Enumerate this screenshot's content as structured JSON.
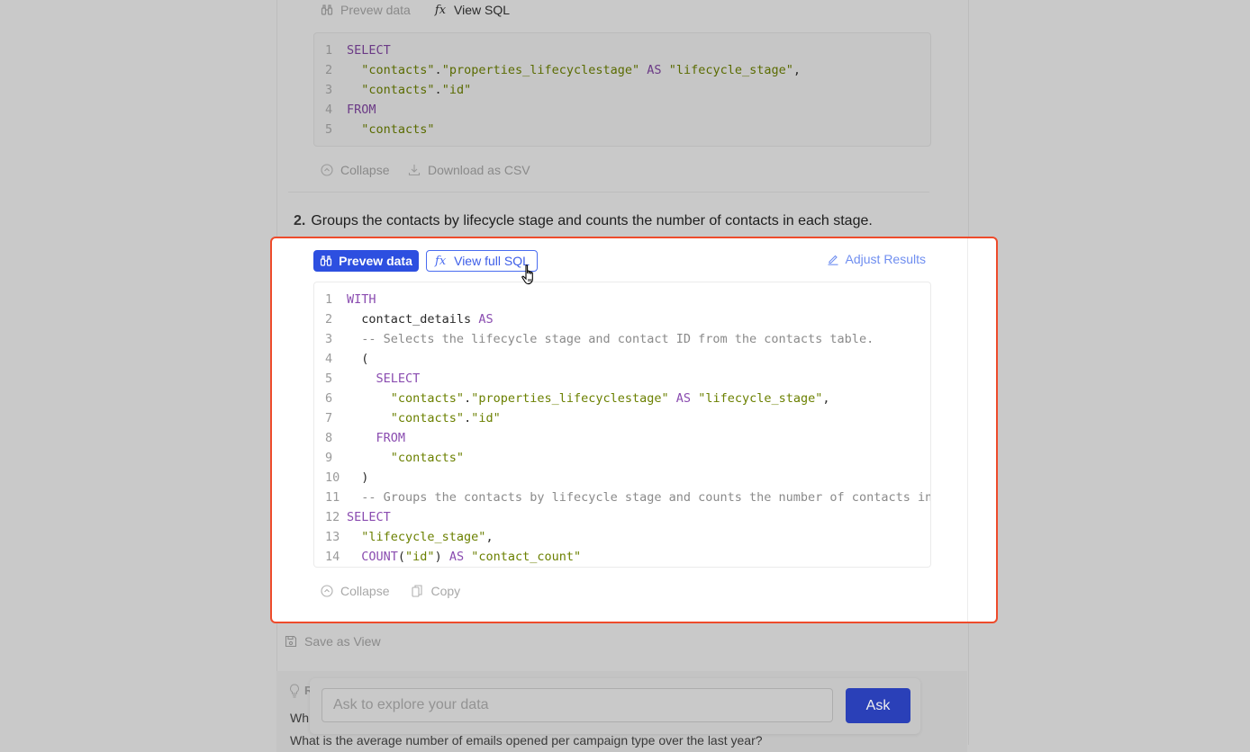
{
  "step1": {
    "toolbar": {
      "preview_label": "Prevew data",
      "view_sql_label": "View SQL"
    },
    "code": [
      {
        "n": "1",
        "tokens": [
          {
            "t": "kw",
            "v": "SELECT"
          }
        ]
      },
      {
        "n": "2",
        "tokens": [
          {
            "t": "pl",
            "v": "  "
          },
          {
            "t": "str",
            "v": "\"contacts\""
          },
          {
            "t": "pl",
            "v": "."
          },
          {
            "t": "str",
            "v": "\"properties_lifecyclestage\""
          },
          {
            "t": "pl",
            "v": " "
          },
          {
            "t": "kw",
            "v": "AS"
          },
          {
            "t": "pl",
            "v": " "
          },
          {
            "t": "str",
            "v": "\"lifecycle_stage\""
          },
          {
            "t": "pl",
            "v": ","
          }
        ]
      },
      {
        "n": "3",
        "tokens": [
          {
            "t": "pl",
            "v": "  "
          },
          {
            "t": "str",
            "v": "\"contacts\""
          },
          {
            "t": "pl",
            "v": "."
          },
          {
            "t": "str",
            "v": "\"id\""
          }
        ]
      },
      {
        "n": "4",
        "tokens": [
          {
            "t": "kw",
            "v": "FROM"
          }
        ]
      },
      {
        "n": "5",
        "tokens": [
          {
            "t": "pl",
            "v": "  "
          },
          {
            "t": "str",
            "v": "\"contacts\""
          }
        ]
      }
    ],
    "footer": {
      "collapse_label": "Collapse",
      "download_label": "Download as CSV"
    }
  },
  "step2": {
    "number": "2.",
    "description": "Groups the contacts by lifecycle stage and counts the number of contacts in each stage.",
    "toolbar": {
      "preview_label": "Prevew data",
      "view_full_sql_label": "View full SQL",
      "adjust_label": "Adjust Results"
    },
    "code": [
      {
        "n": "1",
        "tokens": [
          {
            "t": "kw",
            "v": "WITH"
          }
        ]
      },
      {
        "n": "2",
        "tokens": [
          {
            "t": "pl",
            "v": "  contact_details "
          },
          {
            "t": "kw",
            "v": "AS"
          }
        ]
      },
      {
        "n": "3",
        "tokens": [
          {
            "t": "com",
            "v": "  -- Selects the lifecycle stage and contact ID from the contacts table."
          }
        ]
      },
      {
        "n": "4",
        "tokens": [
          {
            "t": "pl",
            "v": "  ("
          }
        ]
      },
      {
        "n": "5",
        "tokens": [
          {
            "t": "pl",
            "v": "    "
          },
          {
            "t": "kw",
            "v": "SELECT"
          }
        ]
      },
      {
        "n": "6",
        "tokens": [
          {
            "t": "pl",
            "v": "      "
          },
          {
            "t": "str",
            "v": "\"contacts\""
          },
          {
            "t": "pl",
            "v": "."
          },
          {
            "t": "str",
            "v": "\"properties_lifecyclestage\""
          },
          {
            "t": "pl",
            "v": " "
          },
          {
            "t": "kw",
            "v": "AS"
          },
          {
            "t": "pl",
            "v": " "
          },
          {
            "t": "str",
            "v": "\"lifecycle_stage\""
          },
          {
            "t": "pl",
            "v": ","
          }
        ]
      },
      {
        "n": "7",
        "tokens": [
          {
            "t": "pl",
            "v": "      "
          },
          {
            "t": "str",
            "v": "\"contacts\""
          },
          {
            "t": "pl",
            "v": "."
          },
          {
            "t": "str",
            "v": "\"id\""
          }
        ]
      },
      {
        "n": "8",
        "tokens": [
          {
            "t": "pl",
            "v": "    "
          },
          {
            "t": "kw",
            "v": "FROM"
          }
        ]
      },
      {
        "n": "9",
        "tokens": [
          {
            "t": "pl",
            "v": "      "
          },
          {
            "t": "str",
            "v": "\"contacts\""
          }
        ]
      },
      {
        "n": "10",
        "tokens": [
          {
            "t": "pl",
            "v": "  )"
          }
        ]
      },
      {
        "n": "11",
        "tokens": [
          {
            "t": "com",
            "v": "  -- Groups the contacts by lifecycle stage and counts the number of contacts in each stage."
          }
        ]
      },
      {
        "n": "12",
        "tokens": [
          {
            "t": "kw",
            "v": "SELECT"
          }
        ]
      },
      {
        "n": "13",
        "tokens": [
          {
            "t": "pl",
            "v": "  "
          },
          {
            "t": "str",
            "v": "\"lifecycle_stage\""
          },
          {
            "t": "pl",
            "v": ","
          }
        ]
      },
      {
        "n": "14",
        "tokens": [
          {
            "t": "pl",
            "v": "  "
          },
          {
            "t": "kw",
            "v": "COUNT"
          },
          {
            "t": "pl",
            "v": "("
          },
          {
            "t": "str",
            "v": "\"id\""
          },
          {
            "t": "pl",
            "v": ") "
          },
          {
            "t": "kw",
            "v": "AS"
          },
          {
            "t": "pl",
            "v": " "
          },
          {
            "t": "str",
            "v": "\"contact_count\""
          }
        ]
      }
    ],
    "footer": {
      "collapse_label": "Collapse",
      "copy_label": "Copy"
    }
  },
  "save_view_label": "Save as View",
  "recommendations": {
    "title": "R",
    "items": [
      "Wh",
      "What is the average number of emails opened per campaign type over the last year?"
    ]
  },
  "ask": {
    "placeholder": "Ask to explore your data",
    "button_label": "Ask"
  },
  "colors": {
    "highlight_border": "#ee4b2b",
    "primary": "#2d4fe0",
    "ask_button": "#2a40b8"
  }
}
